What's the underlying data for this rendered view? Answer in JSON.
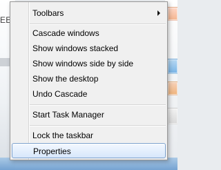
{
  "background": {
    "left_text": "EE"
  },
  "menu": {
    "items": [
      {
        "id": "toolbars",
        "label": "Toolbars",
        "has_submenu": true,
        "icon": "chevron-right-icon"
      },
      {
        "id": "cascade_windows",
        "label": "Cascade windows"
      },
      {
        "id": "show_windows_stacked",
        "label": "Show windows stacked"
      },
      {
        "id": "show_windows_side_by_side",
        "label": "Show windows side by side"
      },
      {
        "id": "show_the_desktop",
        "label": "Show the desktop"
      },
      {
        "id": "undo_cascade",
        "label": "Undo Cascade"
      },
      {
        "id": "start_task_manager",
        "label": "Start Task Manager"
      },
      {
        "id": "lock_the_taskbar",
        "label": "Lock the taskbar"
      },
      {
        "id": "properties",
        "label": "Properties",
        "highlighted": true
      }
    ]
  }
}
